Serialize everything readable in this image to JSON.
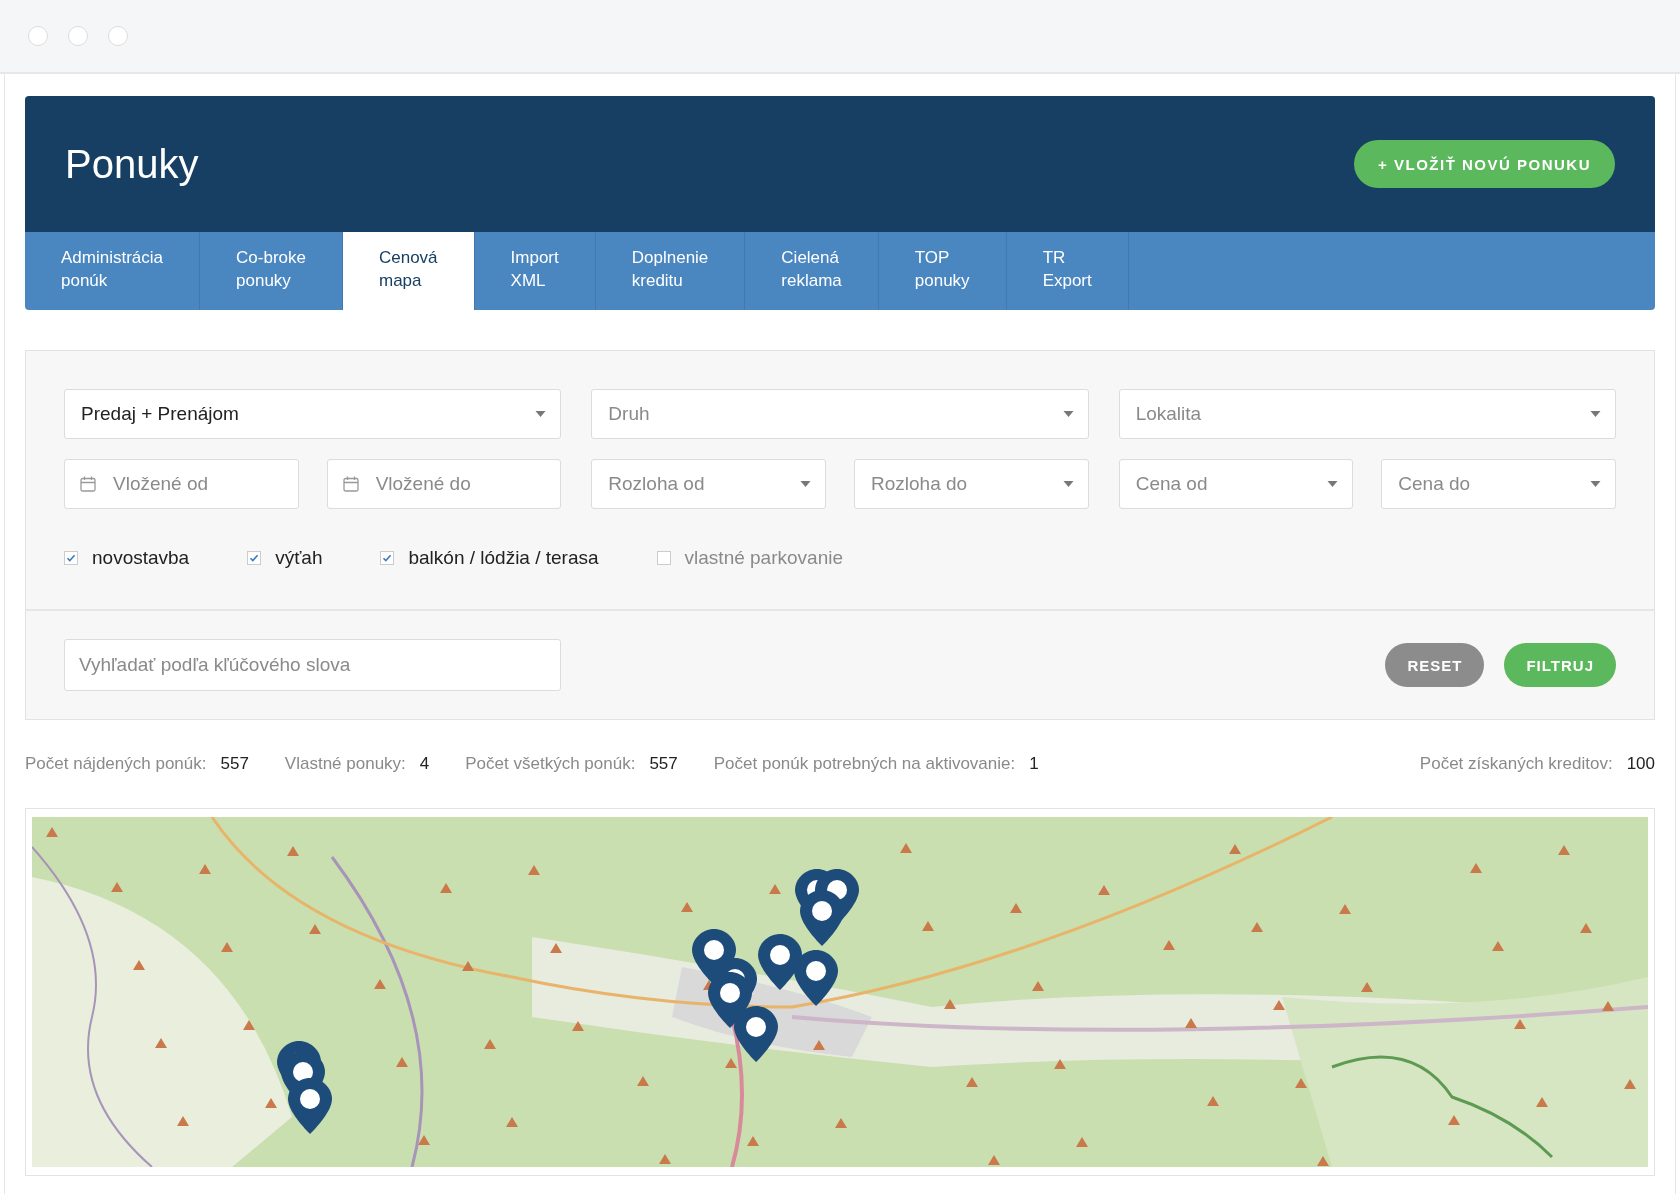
{
  "header": {
    "title": "Ponuky",
    "add_button": "+ VLOŽIŤ NOVÚ PONUKU"
  },
  "tabs": [
    {
      "label": "Administrácia ponúk",
      "selected": false
    },
    {
      "label": "Co-broke ponuky",
      "selected": false
    },
    {
      "label": "Cenová mapa",
      "selected": true
    },
    {
      "label": "Import XML",
      "selected": false
    },
    {
      "label": "Doplnenie kreditu",
      "selected": false
    },
    {
      "label": "Cielená reklama",
      "selected": false
    },
    {
      "label": "TOP ponuky",
      "selected": false
    },
    {
      "label": "TR Export",
      "selected": false
    }
  ],
  "filters": {
    "row_1": [
      {
        "kind": "select",
        "value": "Predaj + Prenájom"
      },
      {
        "kind": "select",
        "placeholder": "Druh"
      },
      {
        "kind": "select",
        "placeholder": "Lokalita"
      }
    ],
    "row_2": [
      {
        "kind": "date",
        "placeholder": "Vložené od"
      },
      {
        "kind": "date",
        "placeholder": "Vložené do"
      },
      {
        "kind": "select",
        "placeholder": "Rozloha od"
      },
      {
        "kind": "select",
        "placeholder": "Rozloha do"
      },
      {
        "kind": "select",
        "placeholder": "Cena od"
      },
      {
        "kind": "select",
        "placeholder": "Cena do"
      }
    ],
    "checkboxes": [
      {
        "label": "novostavba",
        "checked": true
      },
      {
        "label": "výťah",
        "checked": true
      },
      {
        "label": "balkón / lódžia / terasa",
        "checked": true
      },
      {
        "label": "vlastné parkovanie",
        "checked": false
      }
    ],
    "search": {
      "placeholder": "Vyhľadať podľa kľúčového slova"
    },
    "reset_button": "RESET",
    "filter_button": "FILTRUJ"
  },
  "stats": [
    {
      "label": "Počet nájdených ponúk:",
      "value": "557"
    },
    {
      "label": "Vlastné ponuky:",
      "value": "4"
    },
    {
      "label": "Počet všetkých ponúk:",
      "value": "557"
    },
    {
      "label": "Počet ponúk potrebných na aktivovanie:",
      "value": "1"
    },
    {
      "label": "Počet získaných kreditov:",
      "value": "100"
    }
  ]
}
